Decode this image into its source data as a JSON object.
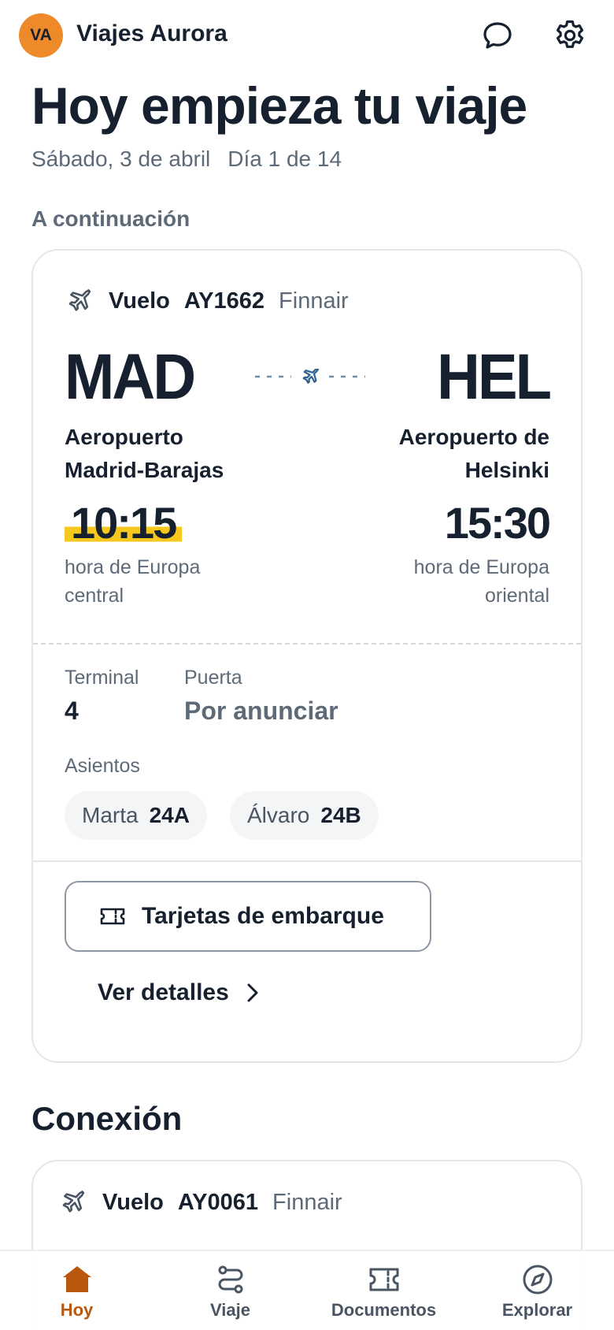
{
  "header": {
    "avatar_initials": "VA",
    "brand": "Viajes Aurora"
  },
  "hero": {
    "title": "Hoy empieza tu viaje",
    "date": "Sábado, 3 de abril",
    "day": "Día 1 de 14"
  },
  "next": {
    "section_label": "A continuación",
    "flight": {
      "label": "Vuelo",
      "number": "AY1662",
      "airline": "Finnair",
      "origin_code": "MAD",
      "destination_code": "HEL",
      "origin_airport_line1": "Aeropuerto",
      "origin_airport_line2": "Madrid-Barajas",
      "destination_airport_line1": "Aeropuerto de",
      "destination_airport_line2": "Helsinki",
      "departure_time": "10:15",
      "arrival_time": "15:30",
      "departure_tz_line1": "hora de Europa",
      "departure_tz_line2": "central",
      "arrival_tz_line1": "hora de Europa",
      "arrival_tz_line2": "oriental",
      "terminal_label": "Terminal",
      "terminal_value": "4",
      "gate_label": "Puerta",
      "gate_value": "Por anunciar",
      "seats_label": "Asientos",
      "seats": [
        {
          "passenger": "Marta",
          "seat": "24A"
        },
        {
          "passenger": "Álvaro",
          "seat": "24B"
        }
      ],
      "boarding_button": "Tarjetas de embarque",
      "details_link": "Ver detalles"
    }
  },
  "connection": {
    "title": "Conexión",
    "flight": {
      "label": "Vuelo",
      "number": "AY0061",
      "airline": "Finnair"
    }
  },
  "nav": {
    "items": [
      {
        "label": "Hoy",
        "icon": "home-icon",
        "active": true
      },
      {
        "label": "Viaje",
        "icon": "route-icon",
        "active": false
      },
      {
        "label": "Documentos",
        "icon": "ticket-icon",
        "active": false
      },
      {
        "label": "Explorar",
        "icon": "compass-icon",
        "active": false
      }
    ]
  },
  "colors": {
    "accent": "#ee8a2a",
    "active_nav": "#b8570d",
    "highlight": "#f6c81e",
    "text": "#16202e",
    "muted": "#5e6a78"
  }
}
